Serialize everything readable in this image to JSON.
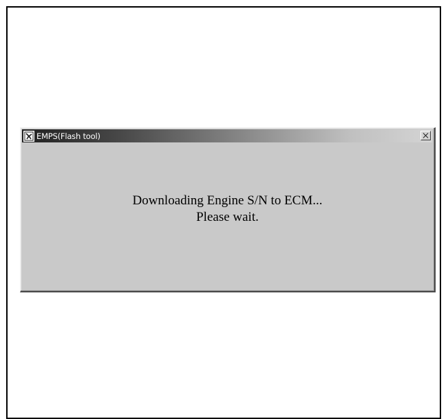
{
  "window": {
    "title": "EMPS(Flash tool)",
    "app_icon": "emps-app-icon",
    "close_icon": "close-icon"
  },
  "message": {
    "line1": "Downloading Engine S/N to ECM...",
    "line2": "Please wait."
  },
  "colors": {
    "dialog_background": "#c9c9c9",
    "titlebar_start": "#202020",
    "titlebar_end": "#d4d4d4",
    "frame_border": "#000000"
  }
}
